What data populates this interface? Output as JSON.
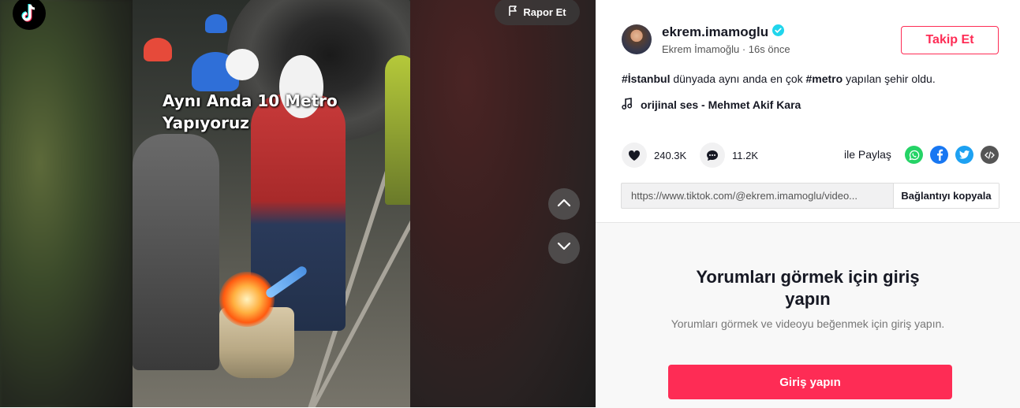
{
  "video": {
    "caption": "Aynı Anda 10 Metro\nYapıyoruz",
    "report_label": "Rapor Et"
  },
  "author": {
    "username": "ekrem.imamoglu",
    "subname": "Ekrem İmamoğlu · 16s önce",
    "follow_label": "Takip Et"
  },
  "description": {
    "tag1": "#İstanbul",
    "text1": " dünyada aynı anda en çok ",
    "tag2": "#metro",
    "text2": " yapılan şehir oldu."
  },
  "music": "orijinal ses - Mehmet Akif Kara",
  "stats": {
    "likes": "240.3K",
    "comments": "11.2K"
  },
  "share": {
    "label": "ile Paylaş",
    "link": "https://www.tiktok.com/@ekrem.imamoglu/video...",
    "copy_label": "Bağlantıyı kopyala"
  },
  "comments_section": {
    "title": "Yorumları görmek için giriş yapın",
    "subtitle": "Yorumları görmek ve videoyu beğenmek için giriş yapın.",
    "login_label": "Giriş yapın"
  },
  "colors": {
    "brand": "#fe2c55",
    "verified": "#20d5ec"
  },
  "icons": [
    "tiktok-logo-icon",
    "flag-icon",
    "chevron-up-icon",
    "chevron-down-icon",
    "verified-icon",
    "music-note-icon",
    "heart-icon",
    "comment-icon",
    "whatsapp-icon",
    "facebook-icon",
    "twitter-icon",
    "embed-icon"
  ]
}
